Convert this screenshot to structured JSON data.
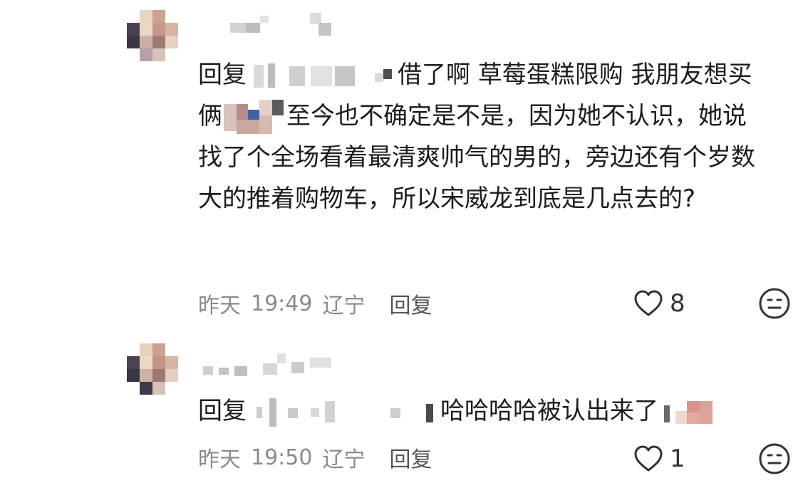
{
  "comments": [
    {
      "reply_label": "回复",
      "text_part1": "借了啊 草莓蛋糕限购 我朋友想买俩",
      "text_part2": "至今也不确定是不是，因为她不认识，她说找了个全场看着最清爽帅气的男的，旁边还有个岁数大的推着购物车，所以宋威龙到底是几点去的?",
      "meta": {
        "date": "昨天",
        "time": "19:49",
        "location": "辽宁",
        "reply": "回复"
      },
      "likes": "8",
      "icons": {
        "like": "heart-outline-icon",
        "reaction": "emoji-icon"
      }
    },
    {
      "reply_label": "回复",
      "text": "哈哈哈哈被认出来了",
      "meta": {
        "date": "昨天",
        "time": "19:50",
        "location": "辽宁",
        "reply": "回复"
      },
      "likes": "1",
      "icons": {
        "like": "heart-outline-icon",
        "reaction": "emoji-icon"
      }
    }
  ]
}
